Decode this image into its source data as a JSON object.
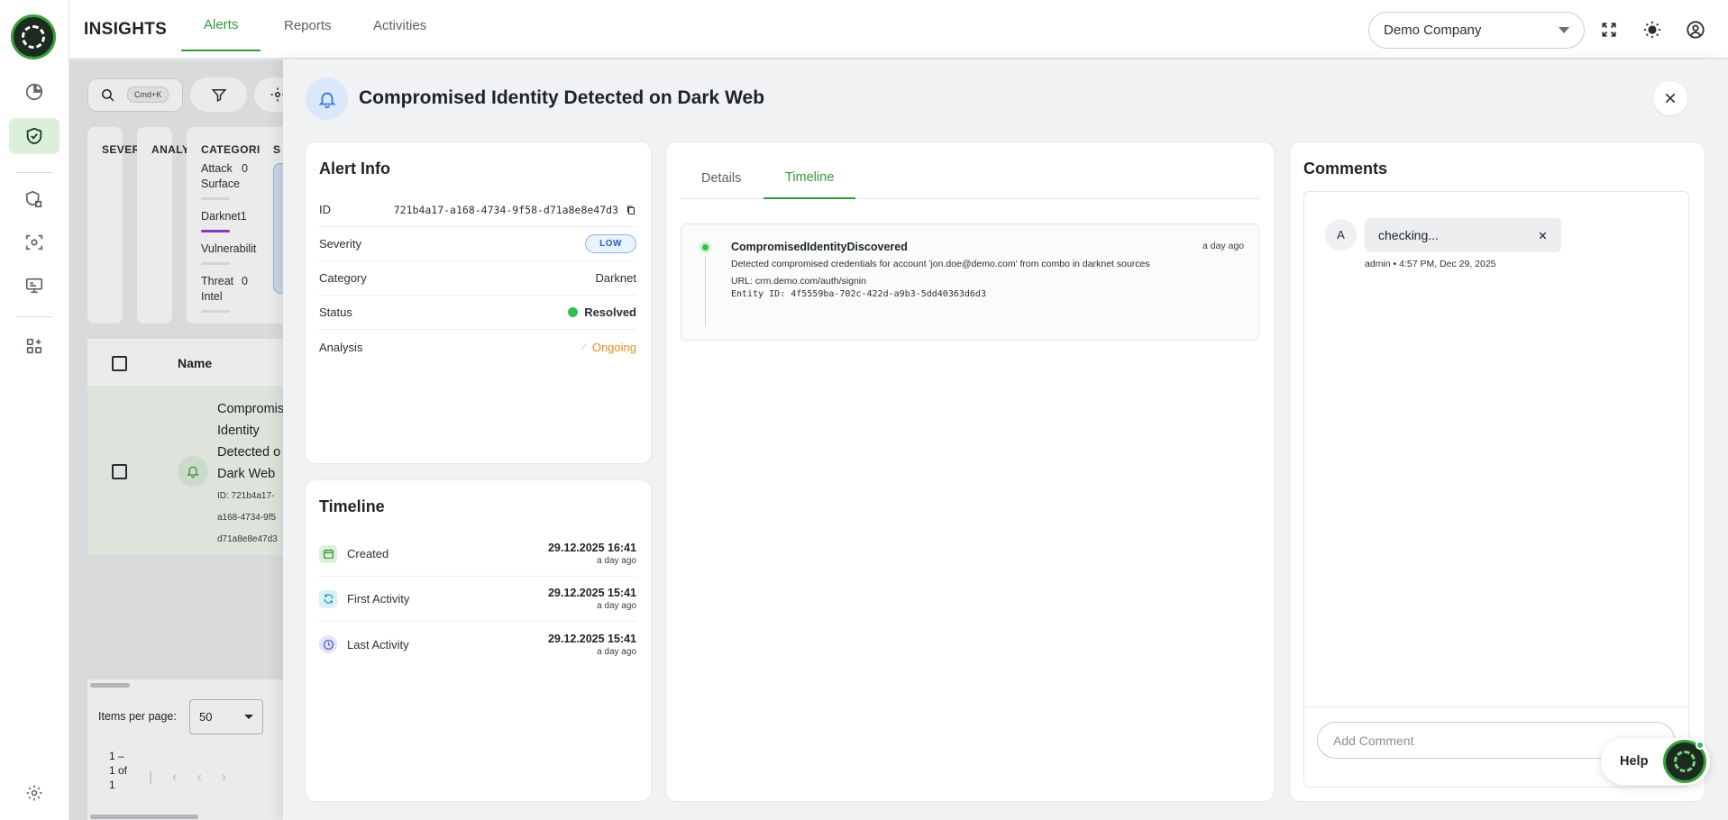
{
  "app": {
    "brand": "INSIGHTS",
    "tabs": [
      {
        "label": "Alerts",
        "active": true
      },
      {
        "label": "Reports",
        "active": false
      },
      {
        "label": "Activities",
        "active": false
      }
    ],
    "company_selector": "Demo Company",
    "accent_color": "#2e9a3a"
  },
  "sidebar": {
    "items": [
      {
        "icon": "dashboard-pie-icon"
      },
      {
        "icon": "shield-check-icon",
        "active": true
      },
      {
        "icon": "shield-stack-icon"
      },
      {
        "icon": "network-scan-icon"
      },
      {
        "icon": "monitor-icon"
      },
      {
        "icon": "apps-add-icon"
      },
      {
        "icon": "settings-gear-icon"
      }
    ]
  },
  "list": {
    "search_shortcut": "Cmd+K",
    "filters": {
      "severity": "SEVER",
      "analysis": "ANALY",
      "category": "CATEGORI",
      "status": "S",
      "category_items": [
        {
          "label": "Attack Surface",
          "count": "0"
        },
        {
          "label": "Darknet",
          "count": "1"
        },
        {
          "label": "Vulnerabilit",
          "count": ""
        },
        {
          "label": "Threat Intel",
          "count": "0"
        }
      ]
    },
    "table": {
      "name_header": "Name",
      "rows": [
        {
          "name": "Compromis Identity Detected o Dark Web",
          "id": "ID: 721b4a17- a168-4734-9f5 d71a8e8e47d3"
        }
      ]
    },
    "pagination": {
      "items_per_page_label": "Items per page:",
      "items_per_page": "50",
      "range": "1 – 1 of 1"
    }
  },
  "drawer": {
    "title": "Compromised Identity Detected on Dark Web",
    "alert_info": {
      "heading": "Alert Info",
      "id_label": "ID",
      "id_value": "721b4a17-a168-4734-9f58-d71a8e8e47d3",
      "severity_label": "Severity",
      "severity_value": "LOW",
      "category_label": "Category",
      "category_value": "Darknet",
      "status_label": "Status",
      "status_value": "Resolved",
      "analysis_label": "Analysis",
      "analysis_value": "Ongoing"
    },
    "timeline": {
      "heading": "Timeline",
      "rows": [
        {
          "label": "Created",
          "date": "29.12.2025 16:41",
          "ago": "a day ago",
          "icon": "calendar-icon"
        },
        {
          "label": "First Activity",
          "date": "29.12.2025 15:41",
          "ago": "a day ago",
          "icon": "refresh-icon"
        },
        {
          "label": "Last Activity",
          "date": "29.12.2025 15:41",
          "ago": "a day ago",
          "icon": "clock-icon"
        }
      ]
    },
    "detail_tabs": [
      {
        "label": "Details",
        "active": false
      },
      {
        "label": "Timeline",
        "active": true
      }
    ],
    "event": {
      "title": "CompromisedIdentityDiscovered",
      "ago": "a day ago",
      "description": "Detected compromised credentials for account 'jon.doe@demo.com' from combo in darknet sources",
      "url": "URL: crm.demo.com/auth/signin",
      "entity": "Entity ID: 4f5559ba-702c-422d-a9b3-5dd40363d6d3"
    },
    "comments": {
      "heading": "Comments",
      "items": [
        {
          "avatar": "A",
          "text": "checking...",
          "meta": "admin • 4:57 PM, Dec 29, 2025"
        }
      ],
      "placeholder": "Add Comment"
    },
    "help_label": "Help"
  }
}
